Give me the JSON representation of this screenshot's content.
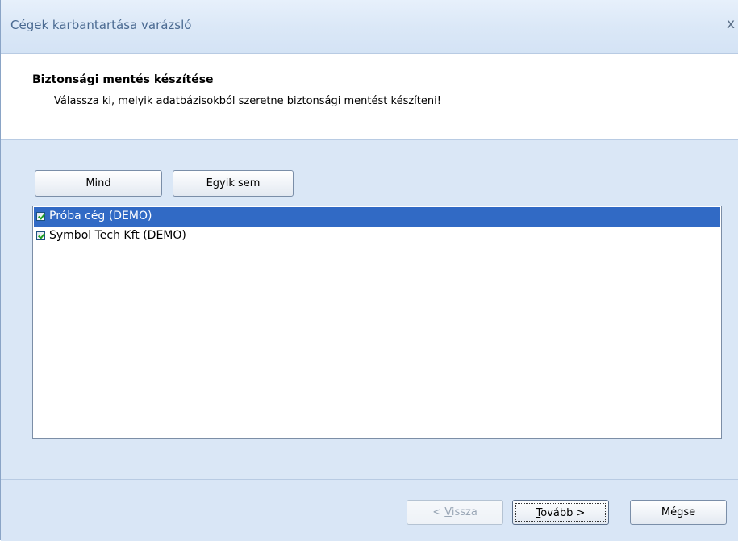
{
  "window": {
    "title": "Cégek karbantartása varázsló",
    "close_glyph": "x"
  },
  "header": {
    "title": "Biztonsági mentés készítése",
    "subtitle": "Válassza ki, melyik adatbázisokból szeretne biztonsági mentést készíteni!"
  },
  "toolbar": {
    "all_label": "Mind",
    "none_label": "Egyik sem"
  },
  "list": {
    "items": [
      {
        "label": "Próba cég (DEMO)",
        "checked": true,
        "selected": true
      },
      {
        "label": "Symbol Tech Kft (DEMO)",
        "checked": true,
        "selected": false
      }
    ]
  },
  "footer": {
    "back_prefix": "< ",
    "back_mnemonic": "V",
    "back_rest": "issza",
    "next_mnemonic": "T",
    "next_rest": "ovább >",
    "cancel_label": "Mégse"
  },
  "colors": {
    "selection": "#316ac5",
    "background": "#dae7f6",
    "title_text": "#4a6a91"
  }
}
